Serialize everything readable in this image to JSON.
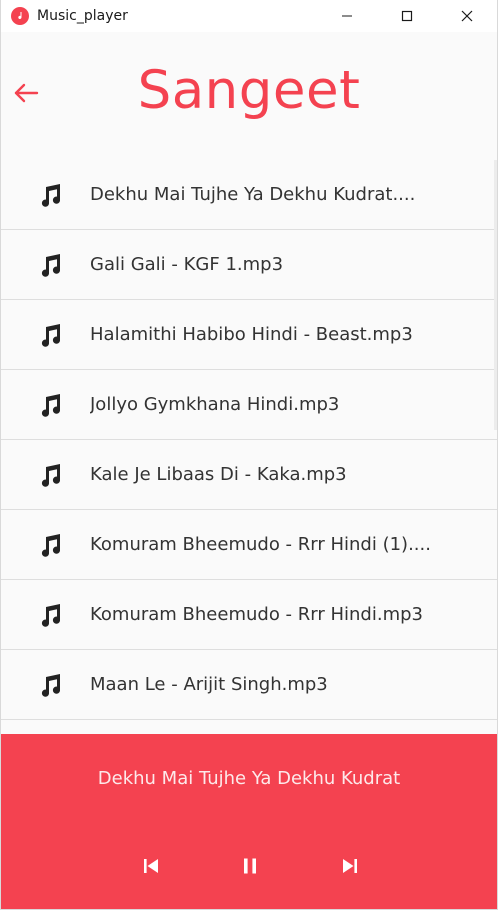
{
  "window": {
    "title": "Music_player"
  },
  "header": {
    "title": "Sangeet"
  },
  "songs": [
    {
      "title": "Dekhu Mai Tujhe Ya Dekhu Kudrat...."
    },
    {
      "title": "Gali Gali - KGF 1.mp3"
    },
    {
      "title": "Halamithi Habibo Hindi - Beast.mp3"
    },
    {
      "title": "Jollyo Gymkhana Hindi.mp3"
    },
    {
      "title": "Kale Je Libaas Di - Kaka.mp3"
    },
    {
      "title": "Komuram Bheemudo - Rrr Hindi (1)...."
    },
    {
      "title": "Komuram Bheemudo - Rrr Hindi.mp3"
    },
    {
      "title": "Maan Le - Arijit Singh.mp3"
    }
  ],
  "player": {
    "now_playing": "Dekhu Mai Tujhe Ya Dekhu Kudrat"
  },
  "colors": {
    "accent": "#f44250",
    "list_background": "#fafafa",
    "divider": "#dedede",
    "text": "#333333"
  },
  "icons": {
    "app": "music-note-icon",
    "back": "arrow-left-icon",
    "song": "music-note-icon",
    "previous": "skip-previous-icon",
    "pause": "pause-icon",
    "next": "skip-next-icon",
    "minimize": "minimize-icon",
    "maximize": "maximize-icon",
    "close": "close-icon"
  }
}
